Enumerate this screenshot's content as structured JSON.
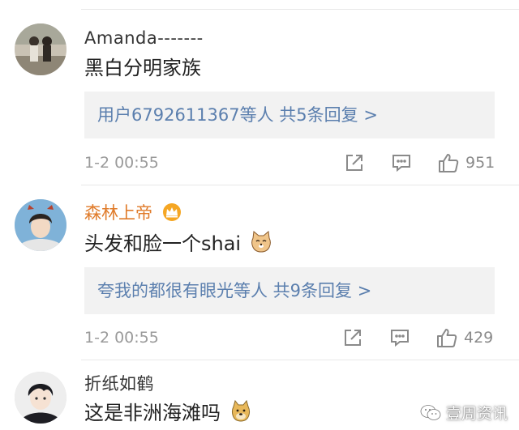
{
  "comments": [
    {
      "username": "Amanda-------",
      "text": "黑白分明家族",
      "reply_summary": "用户6792611367等人 共5条回复 >",
      "timestamp": "1-2 00:55",
      "likes": "951"
    },
    {
      "username": "森林上帝",
      "text": "头发和脸一个shai",
      "reply_summary": "夸我的都很有眼光等人 共9条回复 >",
      "timestamp": "1-2 00:55",
      "likes": "429"
    },
    {
      "username": "折纸如鹤",
      "text": "这是非洲海滩吗"
    }
  ],
  "watermark": "壹周资讯",
  "colors": {
    "vip_name": "#e07b2a",
    "link": "#5b7fae",
    "meta": "#9a9a9a",
    "reply_bg": "#f2f2f2"
  },
  "icons": [
    "crown-icon",
    "cat-emoji",
    "doge-emoji",
    "share-icon",
    "comment-icon",
    "like-icon",
    "wechat-icon"
  ]
}
